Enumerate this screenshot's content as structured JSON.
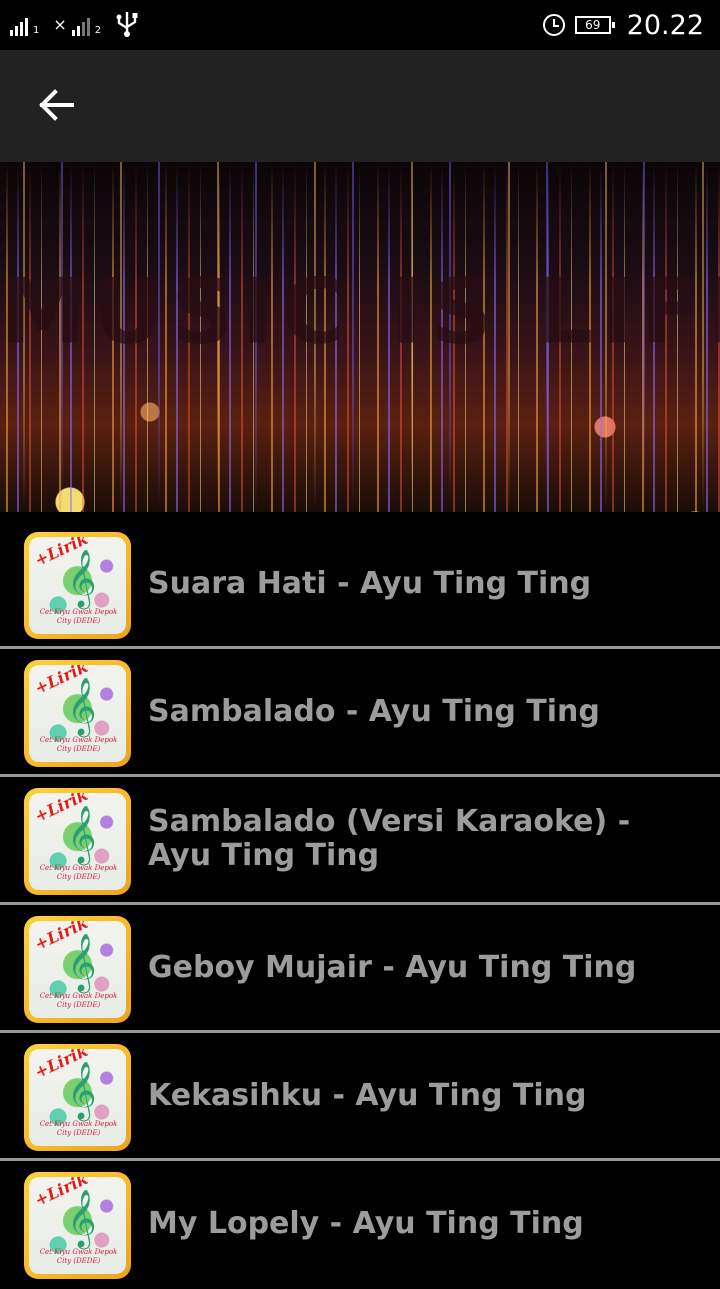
{
  "status_bar": {
    "sim1_sub": "1",
    "sim2_prefix": "×",
    "sim2_sub": "2",
    "battery_level": "69",
    "time": "20.22"
  },
  "toolbar": {
    "back_icon": "arrow-back-icon"
  },
  "banner": {
    "text": "MUSIC IS LIFE"
  },
  "thumbnail": {
    "badge": "+Lirik",
    "signature": "Cet Kiyu Gwak Depok City (DEDE)"
  },
  "songs": [
    {
      "title": "Suara Hati - Ayu Ting Ting"
    },
    {
      "title": "Sambalado - Ayu Ting Ting"
    },
    {
      "title": "Sambalado (Versi Karaoke) - Ayu Ting Ting"
    },
    {
      "title": "Geboy Mujair - Ayu Ting Ting"
    },
    {
      "title": "Kekasihku - Ayu Ting Ting"
    },
    {
      "title": "My Lopely - Ayu Ting Ting"
    }
  ],
  "colors": {
    "toolbar_bg": "#222222",
    "list_bg": "#000000",
    "divider": "#999999",
    "title_text": "#9c9c9c"
  }
}
